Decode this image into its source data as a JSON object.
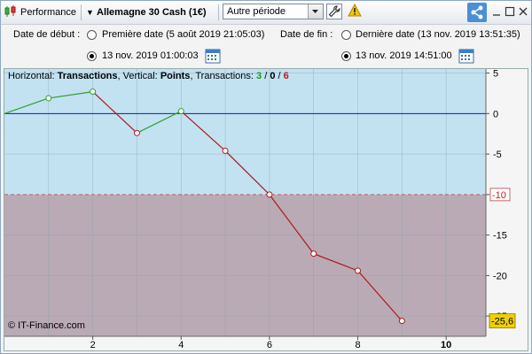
{
  "toolbar": {
    "title": "Performance",
    "instrument": "Allemagne 30 Cash (1€)",
    "period": "Autre période"
  },
  "filters": {
    "start_label": "Date de début :",
    "start_first": "Première date (5 août 2019 21:05:03)",
    "start_custom": "13 nov. 2019 01:00:03",
    "end_label": "Date de fin :",
    "end_last": "Dernière date (13 nov. 2019 13:51:35)",
    "end_custom": "13 nov. 2019 14:51:00"
  },
  "chart": {
    "horizontal_label": "Horizontal:",
    "horizontal_value": "Transactions",
    "vertical_label": ", Vertical:",
    "vertical_value": "Points",
    "transactions_label": ", Transactions:",
    "wins": "3",
    "sep1": " / ",
    "neutral": "0",
    "sep2": " / ",
    "losses": "6",
    "copyright": "© IT-Finance.com",
    "threshold_label": "-10",
    "last_label": "-25,6"
  },
  "chart_data": {
    "type": "line",
    "x": [
      0,
      1,
      2,
      3,
      4,
      5,
      6,
      7,
      8,
      9
    ],
    "values": [
      0,
      1.9,
      2.7,
      -2.4,
      0.3,
      -4.6,
      -10.0,
      -17.3,
      -19.4,
      -25.6
    ],
    "xlim": [
      0,
      10.9
    ],
    "ylim": [
      -27.5,
      5.5
    ],
    "x_ticks": [
      "2",
      "4",
      "6",
      "8",
      "10"
    ],
    "y_ticks": [
      "5",
      "0",
      "-5",
      "-10",
      "-15",
      "-20",
      "-25"
    ],
    "threshold": -10,
    "colors": {
      "up": "#2ea02e",
      "down": "#b01818",
      "zero_line": "#1a1aa0",
      "top_fill": "#c2e2f2",
      "bottom_fill": "#baaab6"
    }
  }
}
